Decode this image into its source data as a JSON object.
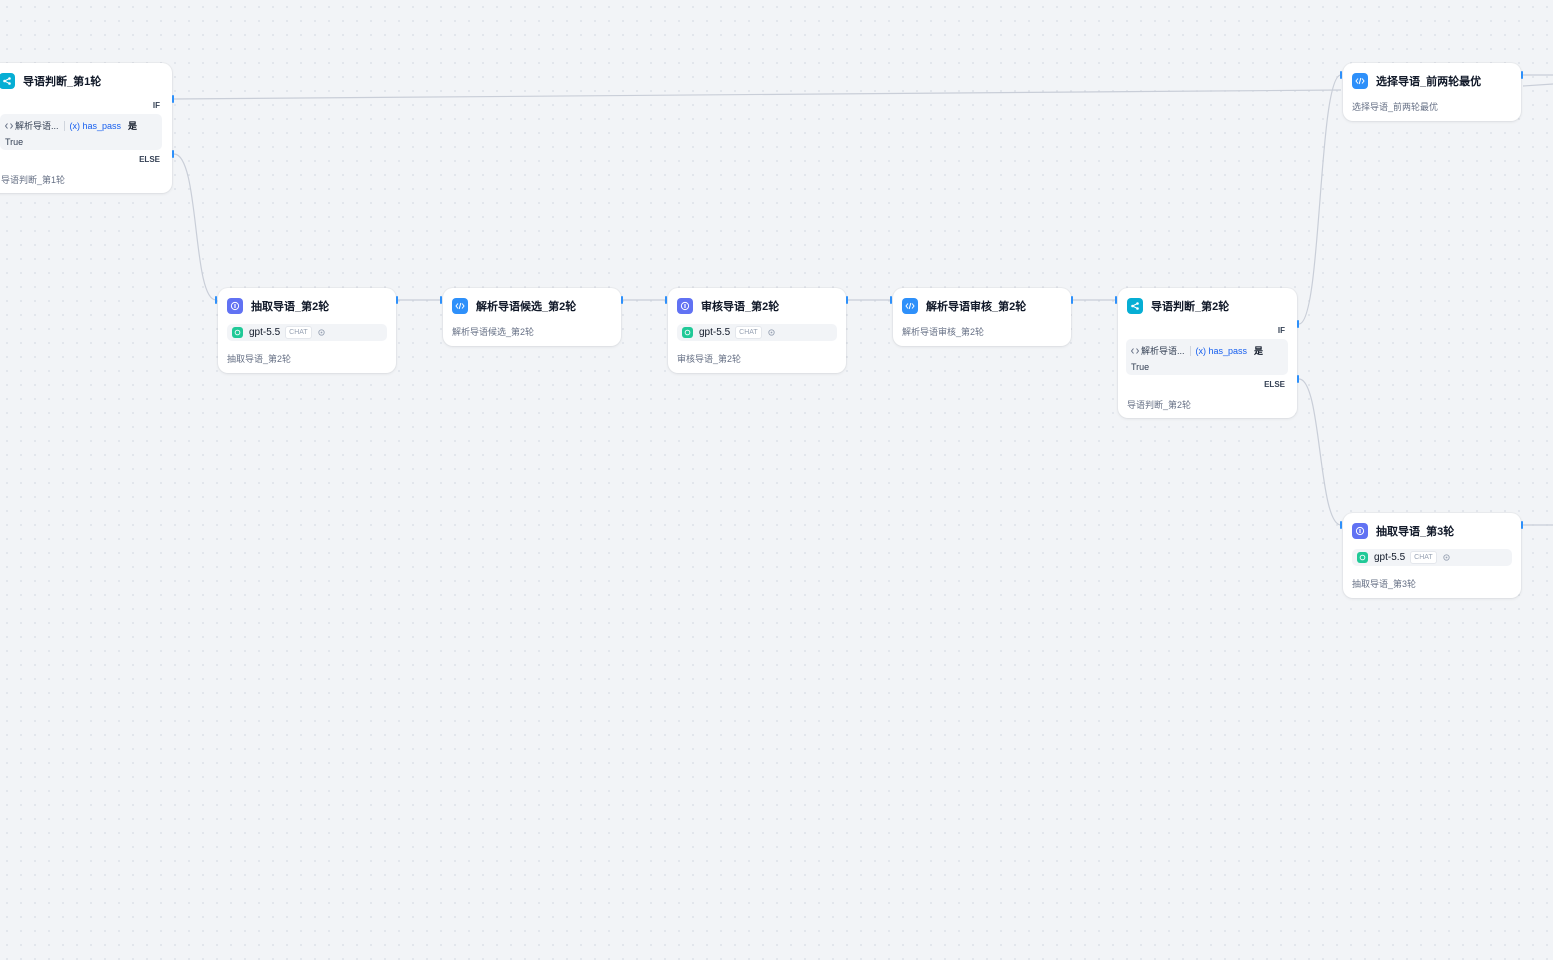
{
  "nodes": {
    "if1": {
      "title": "导语判断_第1轮",
      "case_if": "IF",
      "case_else": "ELSE",
      "cond_var": "解析导语...",
      "cond_field": "(x) has_pass",
      "cond_op": "是",
      "cond_value": "True",
      "desc": "导语判断_第1轮"
    },
    "select_best": {
      "title": "选择导语_前两轮最优",
      "desc": "选择导语_前两轮最优"
    },
    "llm_extract2": {
      "title": "抽取导语_第2轮",
      "model": "gpt-5.5",
      "mode": "CHAT",
      "desc": "抽取导语_第2轮"
    },
    "code_parse2": {
      "title": "解析导语候选_第2轮",
      "desc": "解析导语候选_第2轮"
    },
    "llm_review2": {
      "title": "审核导语_第2轮",
      "model": "gpt-5.5",
      "mode": "CHAT",
      "desc": "审核导语_第2轮"
    },
    "code_review2": {
      "title": "解析导语审核_第2轮",
      "desc": "解析导语审核_第2轮"
    },
    "if2": {
      "title": "导语判断_第2轮",
      "case_if": "IF",
      "case_else": "ELSE",
      "cond_var": "解析导语...",
      "cond_field": "(x) has_pass",
      "cond_op": "是",
      "cond_value": "True",
      "desc": "导语判断_第2轮"
    },
    "llm_extract3": {
      "title": "抽取导语_第3轮",
      "model": "gpt-5.5",
      "mode": "CHAT",
      "desc": "抽取导语_第3轮"
    }
  },
  "colors": {
    "edge": "#c9ced8",
    "handle": "#2e90fa",
    "if_icon": "#06aed4",
    "code_icon": "#2e90fa",
    "llm_icon": "#6172f3",
    "gpt_icon": "#20c997",
    "canvas": "#f2f4f7"
  }
}
